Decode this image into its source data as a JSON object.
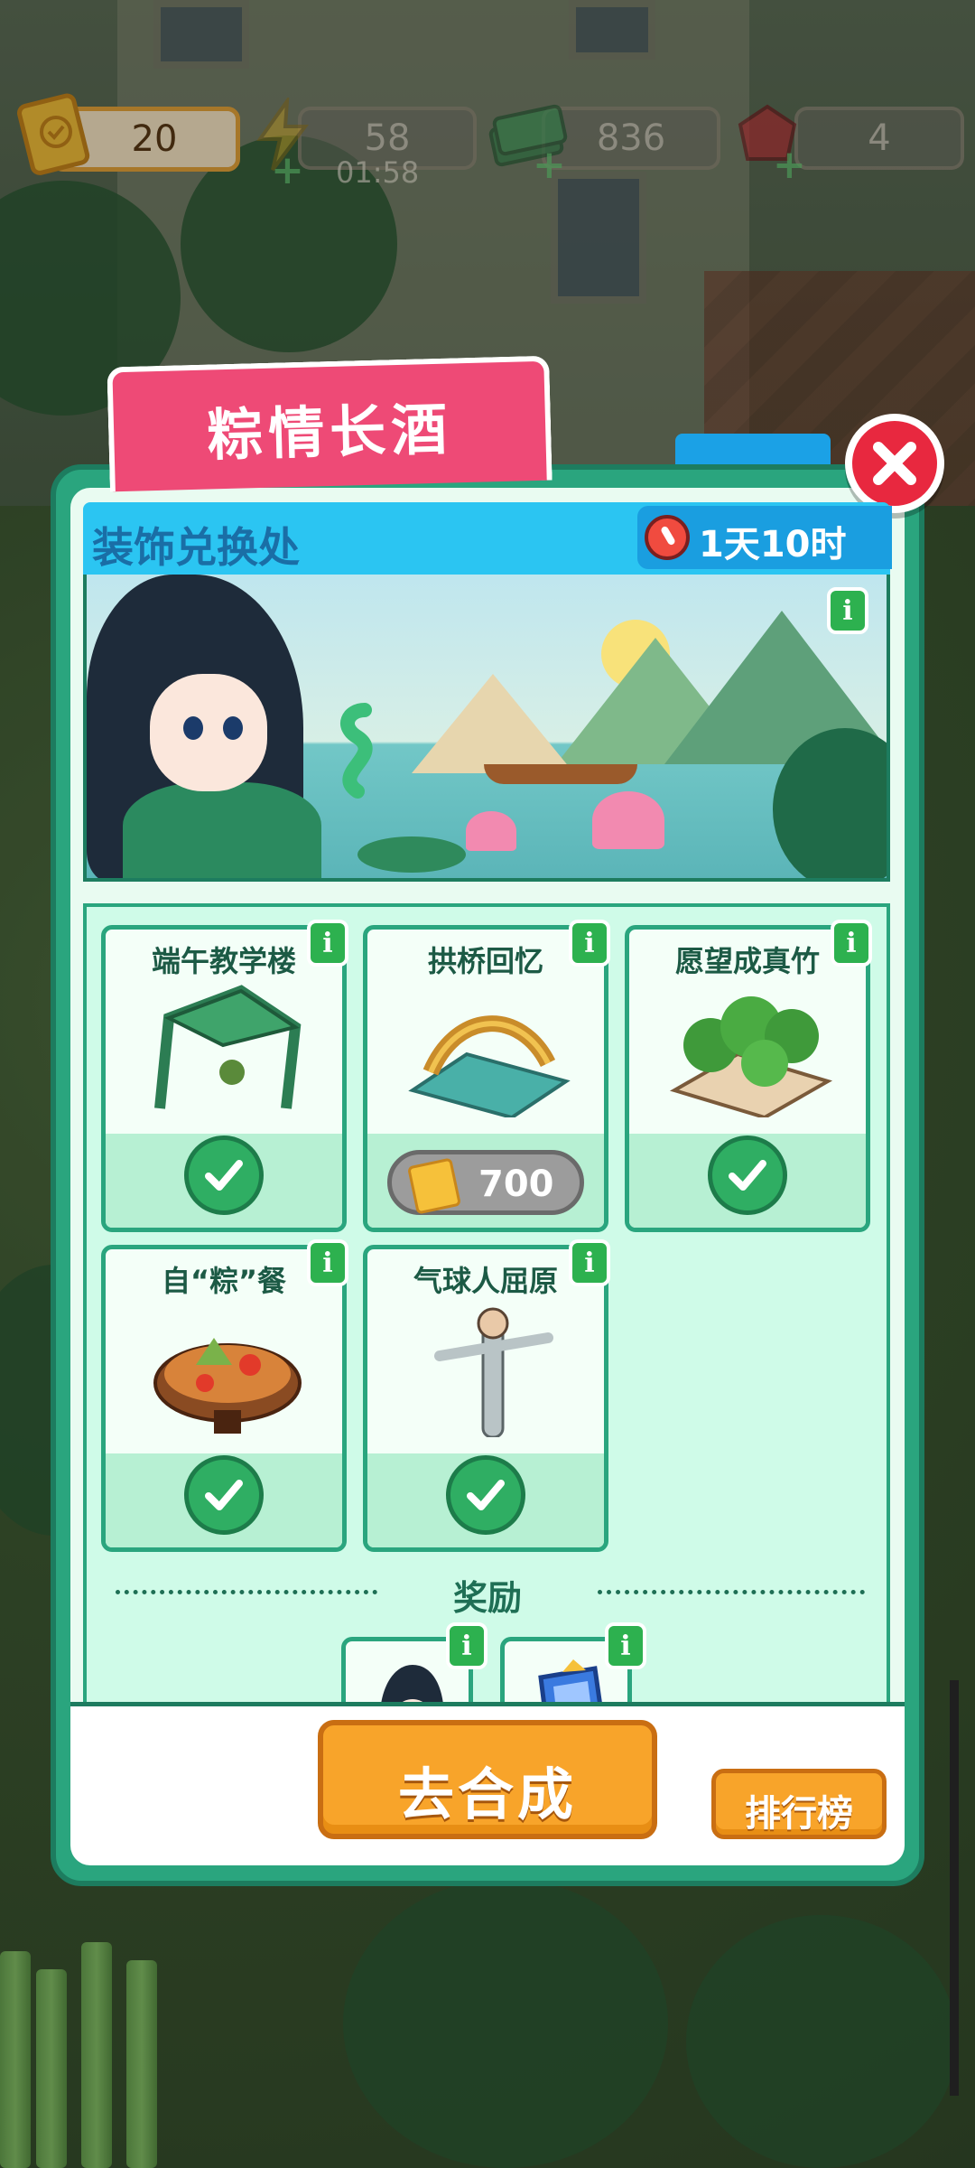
{
  "top_bar": {
    "tickets": "20",
    "energy": "58",
    "energy_timer": "01:58",
    "cash": "836",
    "gems": "4"
  },
  "event": {
    "title": "粽情长酒",
    "section_label": "装饰兑换处",
    "countdown": "1天10时"
  },
  "items": [
    {
      "name": "端午教学楼",
      "status": "owned",
      "icon": "tent-arch-icon"
    },
    {
      "name": "拱桥回忆",
      "status": "buy",
      "price": "700",
      "icon": "bridge-icon"
    },
    {
      "name": "愿望成真竹",
      "status": "owned",
      "icon": "bamboo-planter-icon"
    },
    {
      "name": "自“粽”餐",
      "status": "owned",
      "icon": "zongzi-table-icon"
    },
    {
      "name": "气球人屈原",
      "status": "owned",
      "icon": "balloon-man-icon"
    }
  ],
  "rewards": {
    "title": "奖励"
  },
  "buttons": {
    "go_merge": "去合成",
    "leaderboard": "排行榜"
  },
  "colors": {
    "panel_green": "#2aa57e",
    "banner_pink": "#ee4a76",
    "header_blue": "#2bc5f2",
    "button_orange": "#f8a42a",
    "close_red": "#e8283f"
  }
}
